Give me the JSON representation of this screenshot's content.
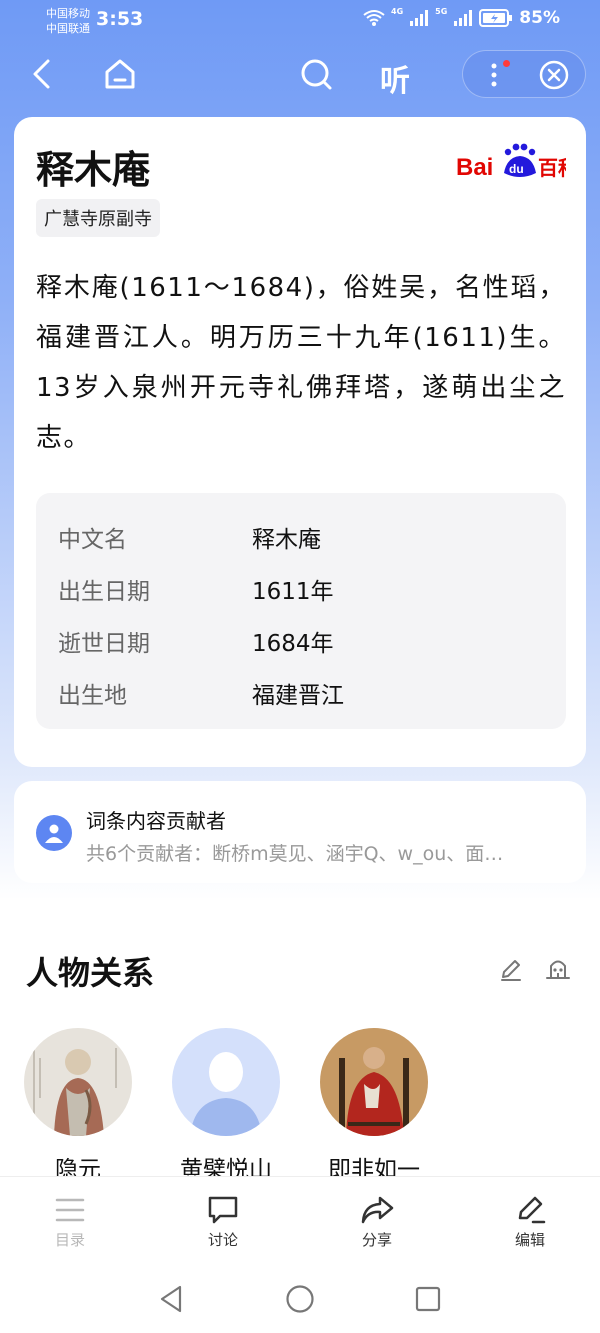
{
  "status_bar": {
    "carrier1": "中国移动",
    "carrier2": "中国联通",
    "time": "3:53",
    "signal1_label": "4G",
    "signal2_label": "5G",
    "battery": "85%"
  },
  "nav": {
    "listen_label": "听"
  },
  "entry": {
    "title": "释木庵",
    "brand": "百科",
    "subtitle": "广慧寺原副寺",
    "summary": "释木庵(1611～1684)，俗姓吴，名性瑫，福建晋江人。明万历三十九年(1611)生。13岁入泉州开元寺礼佛拜塔，遂萌出尘之志。",
    "info": [
      {
        "key": "中文名",
        "value": "释木庵"
      },
      {
        "key": "出生日期",
        "value": "1611年"
      },
      {
        "key": "逝世日期",
        "value": "1684年"
      },
      {
        "key": "出生地",
        "value": "福建晋江"
      }
    ]
  },
  "contributors": {
    "title": "词条内容贡献者",
    "subtitle": "共6个贡献者：断桥m莫见、涵宇Q、w_ou、面…"
  },
  "relations": {
    "title": "人物关系",
    "people": [
      {
        "name": "隐元"
      },
      {
        "name": "黄檗悦山"
      },
      {
        "name": "即非如一"
      }
    ]
  },
  "toolbar": {
    "toc": "目录",
    "discuss": "讨论",
    "share": "分享",
    "edit": "编辑"
  },
  "colors": {
    "accent": "#5d86f2",
    "baidu_red": "#e10602",
    "baidu_blue": "#2319dc"
  }
}
